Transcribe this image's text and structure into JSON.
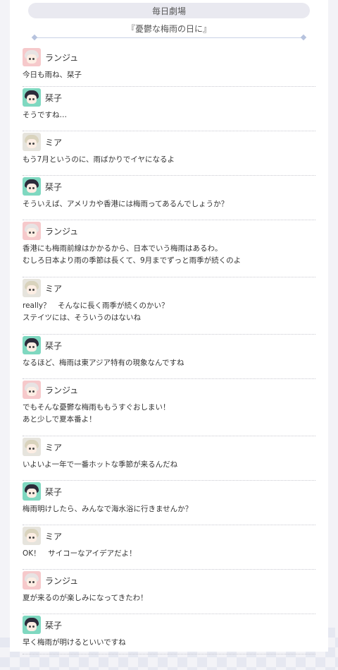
{
  "header": {
    "section": "毎日劇場",
    "title": "『憂鬱な梅雨の日に』"
  },
  "messages": [
    {
      "speaker": "ランジュ",
      "avatar": "ranju",
      "text": "今日も雨ね、栞子"
    },
    {
      "speaker": "栞子",
      "avatar": "kotoko",
      "text": "そうですね…"
    },
    {
      "speaker": "ミア",
      "avatar": "mia",
      "text": "もう7月というのに、雨ばかりでイヤになるよ"
    },
    {
      "speaker": "栞子",
      "avatar": "kotoko",
      "text": "そういえば、アメリカや香港には梅雨ってあるんでしょうか？"
    },
    {
      "speaker": "ランジュ",
      "avatar": "ranju",
      "text": "香港にも梅雨前線はかかるから、日本でいう梅雨はあるわ。\nむしろ日本より雨の季節は長くて、9月までずっと雨季が続くのよ"
    },
    {
      "speaker": "ミア",
      "avatar": "mia",
      "text": "really？　そんなに長く雨季が続くのかい？\nステイツには、そういうのはないね"
    },
    {
      "speaker": "栞子",
      "avatar": "kotoko",
      "text": "なるほど、梅雨は東アジア特有の現象なんですね"
    },
    {
      "speaker": "ランジュ",
      "avatar": "ranju",
      "text": "でもそんな憂鬱な梅雨ももうすぐおしまい！\nあと少しで夏本番よ！"
    },
    {
      "speaker": "ミア",
      "avatar": "mia",
      "text": "いよいよ一年で一番ホットな季節が来るんだね"
    },
    {
      "speaker": "栞子",
      "avatar": "kotoko",
      "text": "梅雨明けしたら、みんなで海水浴に行きませんか？"
    },
    {
      "speaker": "ミア",
      "avatar": "mia",
      "text": "OK！　サイコーなアイデアだよ！"
    },
    {
      "speaker": "ランジュ",
      "avatar": "ranju",
      "text": "夏が来るのが楽しみになってきたわ！"
    },
    {
      "speaker": "栞子",
      "avatar": "kotoko",
      "text": "早く梅雨が明けるといいですね"
    }
  ]
}
